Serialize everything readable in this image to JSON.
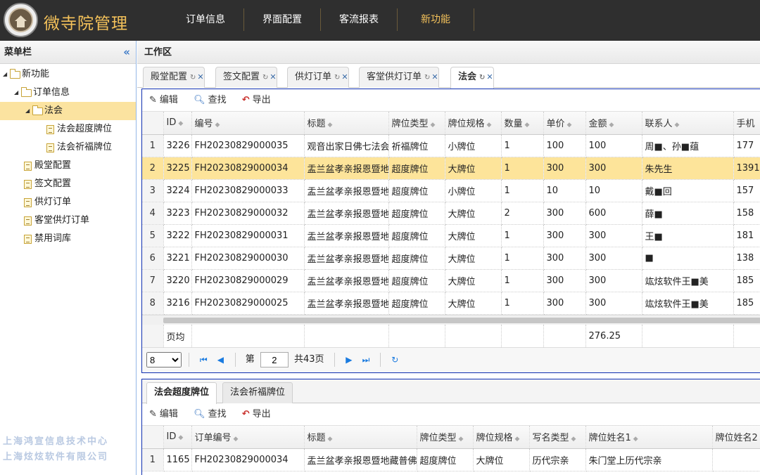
{
  "app": {
    "title": "微寺院管理"
  },
  "topnav": [
    "订单信息",
    "界面配置",
    "客流报表",
    "新功能"
  ],
  "sidebar": {
    "title": "菜单栏",
    "items": [
      {
        "label": "新功能"
      },
      {
        "label": "订单信息"
      },
      {
        "label": "法会"
      },
      {
        "label": "法会超度牌位"
      },
      {
        "label": "法会祈福牌位"
      },
      {
        "label": "殿堂配置"
      },
      {
        "label": "签文配置"
      },
      {
        "label": "供灯订单"
      },
      {
        "label": "客堂供灯订单"
      },
      {
        "label": "禁用词库"
      }
    ],
    "watermark": [
      "上海鸿宣信息技术中心",
      "上海炫炫软件有限公司"
    ]
  },
  "workspace": {
    "title": "工作区",
    "tabs": [
      "殿堂配置",
      "签文配置",
      "供灯订单",
      "客堂供灯订单",
      "法会"
    ]
  },
  "toolbar": {
    "edit": "编辑",
    "find": "查找",
    "export": "导出"
  },
  "main_grid": {
    "columns": [
      "ID",
      "编号",
      "标题",
      "牌位类型",
      "牌位规格",
      "数量",
      "单价",
      "金额",
      "联系人",
      "手机"
    ],
    "rows": [
      [
        "1",
        "3226",
        "FH20230829000035",
        "观音出家日佛七法会",
        "祈福牌位",
        "小牌位",
        "1",
        "100",
        "100",
        "周■、孙■蕴",
        "177"
      ],
      [
        "2",
        "3225",
        "FH20230829000034",
        "盂兰盆孝亲报恩暨地藏普佛",
        "超度牌位",
        "大牌位",
        "1",
        "300",
        "300",
        "朱先生",
        "1391"
      ],
      [
        "3",
        "3224",
        "FH20230829000033",
        "盂兰盆孝亲报恩暨地藏普佛",
        "超度牌位",
        "小牌位",
        "1",
        "10",
        "10",
        "戴■回",
        "157"
      ],
      [
        "4",
        "3223",
        "FH20230829000032",
        "盂兰盆孝亲报恩暨地藏普佛",
        "超度牌位",
        "大牌位",
        "2",
        "300",
        "600",
        "薛■",
        "158"
      ],
      [
        "5",
        "3222",
        "FH20230829000031",
        "盂兰盆孝亲报恩暨地藏普佛",
        "超度牌位",
        "大牌位",
        "1",
        "300",
        "300",
        "王■",
        "181"
      ],
      [
        "6",
        "3221",
        "FH20230829000030",
        "盂兰盆孝亲报恩暨地藏普佛",
        "超度牌位",
        "大牌位",
        "1",
        "300",
        "300",
        "■",
        "138"
      ],
      [
        "7",
        "3220",
        "FH20230829000029",
        "盂兰盆孝亲报恩暨地藏普佛",
        "超度牌位",
        "大牌位",
        "1",
        "300",
        "300",
        "竑炫软件王■美",
        "185"
      ],
      [
        "8",
        "3216",
        "FH20230829000025",
        "盂兰盆孝亲报恩暨地藏普佛",
        "超度牌位",
        "大牌位",
        "1",
        "300",
        "300",
        "竑炫软件王■美",
        "185"
      ]
    ],
    "footer_label": "页均",
    "footer_amount": "276.25"
  },
  "pager": {
    "page_size": "8",
    "page_label": "第",
    "page": "2",
    "total_label": "共43页"
  },
  "sub_tabs": [
    "法会超度牌位",
    "法会祈福牌位"
  ],
  "sub_grid": {
    "columns": [
      "ID",
      "订单编号",
      "标题",
      "牌位类型",
      "牌位规格",
      "写名类型",
      "牌位姓名1",
      "牌位姓名2"
    ],
    "rows": [
      [
        "1",
        "1165",
        "FH20230829000034",
        "盂兰盆孝亲报恩暨地藏普佛",
        "超度牌位",
        "大牌位",
        "历代宗亲",
        "朱门堂上历代宗亲",
        ""
      ]
    ]
  }
}
